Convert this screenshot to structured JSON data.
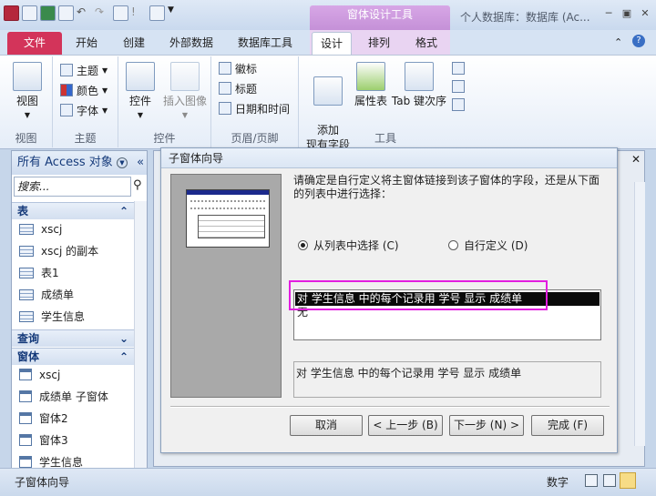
{
  "window": {
    "title": "个人数据库：数据库 (Ac...",
    "context_tool": "窗体设计工具",
    "controls": [
      "─",
      "▣",
      "✕"
    ]
  },
  "ribbon_tabs": [
    "文件",
    "开始",
    "创建",
    "外部数据",
    "数据库工具",
    "设计",
    "排列",
    "格式"
  ],
  "ribbon": {
    "view": {
      "label": "视图",
      "group": "视图"
    },
    "theme": {
      "items": [
        "主题",
        "颜色",
        "字体"
      ],
      "group": "主题"
    },
    "controls": {
      "label": "控件",
      "insert_image": "插入图像",
      "group": "控件"
    },
    "header_footer": {
      "items": [
        "徽标",
        "标题",
        "日期和时间"
      ],
      "group": "页眉/页脚"
    },
    "tools": {
      "add_field": "添加\n现有字段",
      "property_sheet": "属性表",
      "tab_order": "Tab 键次序",
      "group": "工具"
    }
  },
  "nav": {
    "header": "所有 Access 对象",
    "search_placeholder": "搜索...",
    "sections": [
      {
        "title": "表",
        "items": [
          "xscj",
          "xscj 的副本",
          "表1",
          "成绩单",
          "学生信息"
        ]
      },
      {
        "title": "查询",
        "items": []
      },
      {
        "title": "窗体",
        "items": [
          "xscj",
          "成绩单 子窗体",
          "窗体2",
          "窗体3",
          "学生信息"
        ]
      }
    ]
  },
  "dialog": {
    "title": "子窗体向导",
    "instruction": "请确定是自行定义将主窗体链接到该子窗体的字段，还是从下面的列表中进行选择：",
    "option_list": "从列表中选择 (C)",
    "option_custom": "自行定义 (D)",
    "list_items": [
      "对 学生信息 中的每个记录用 学号 显示 成绩单",
      "无"
    ],
    "selected_index": 0,
    "description": "对 学生信息 中的每个记录用 学号 显示 成绩单",
    "buttons": {
      "cancel": "取消",
      "back": "< 上一步 (B)",
      "next": "下一步 (N) >",
      "finish": "完成 (F)"
    }
  },
  "status": {
    "left": "子窗体向导",
    "right": "数字"
  }
}
